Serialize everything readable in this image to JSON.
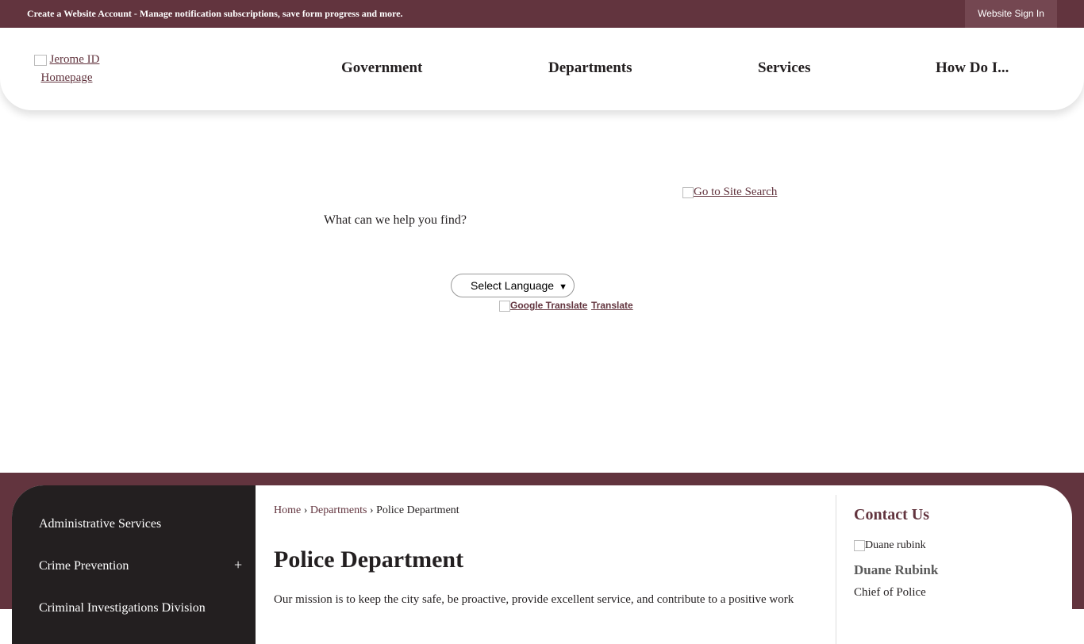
{
  "topbar": {
    "account_link": "Create a Website Account",
    "account_desc": " - Manage notification subscriptions, save form progress and more.",
    "signin_label": "Website Sign In"
  },
  "header": {
    "logo_alt": "Jerome ID Homepage",
    "nav": [
      "Government",
      "Departments",
      "Services",
      "How Do I..."
    ]
  },
  "search": {
    "go_to_search": "Go to Site Search",
    "help_label": "What can we help you find?"
  },
  "translate": {
    "select_label": "Select Language",
    "google_alt": "Google Translate",
    "translate_link": "Translate"
  },
  "sidebar": {
    "items": [
      {
        "label": "Administrative Services",
        "expandable": false
      },
      {
        "label": "Crime Prevention",
        "expandable": true,
        "toggle": "+"
      },
      {
        "label": "Criminal Investigations Division",
        "expandable": false
      }
    ]
  },
  "breadcrumb": {
    "home": "Home",
    "sep": "›",
    "departments": "Departments",
    "current": "Police Department"
  },
  "main": {
    "title": "Police Department",
    "mission": "Our mission is to keep the city safe, be proactive, provide excellent service, and contribute to a positive work"
  },
  "contact": {
    "title": "Contact Us",
    "img_alt": "Duane rubink",
    "name": "Duane Rubink",
    "role": "Chief of Police"
  },
  "colors": {
    "brand": "#62343e",
    "dark": "#231f20"
  }
}
